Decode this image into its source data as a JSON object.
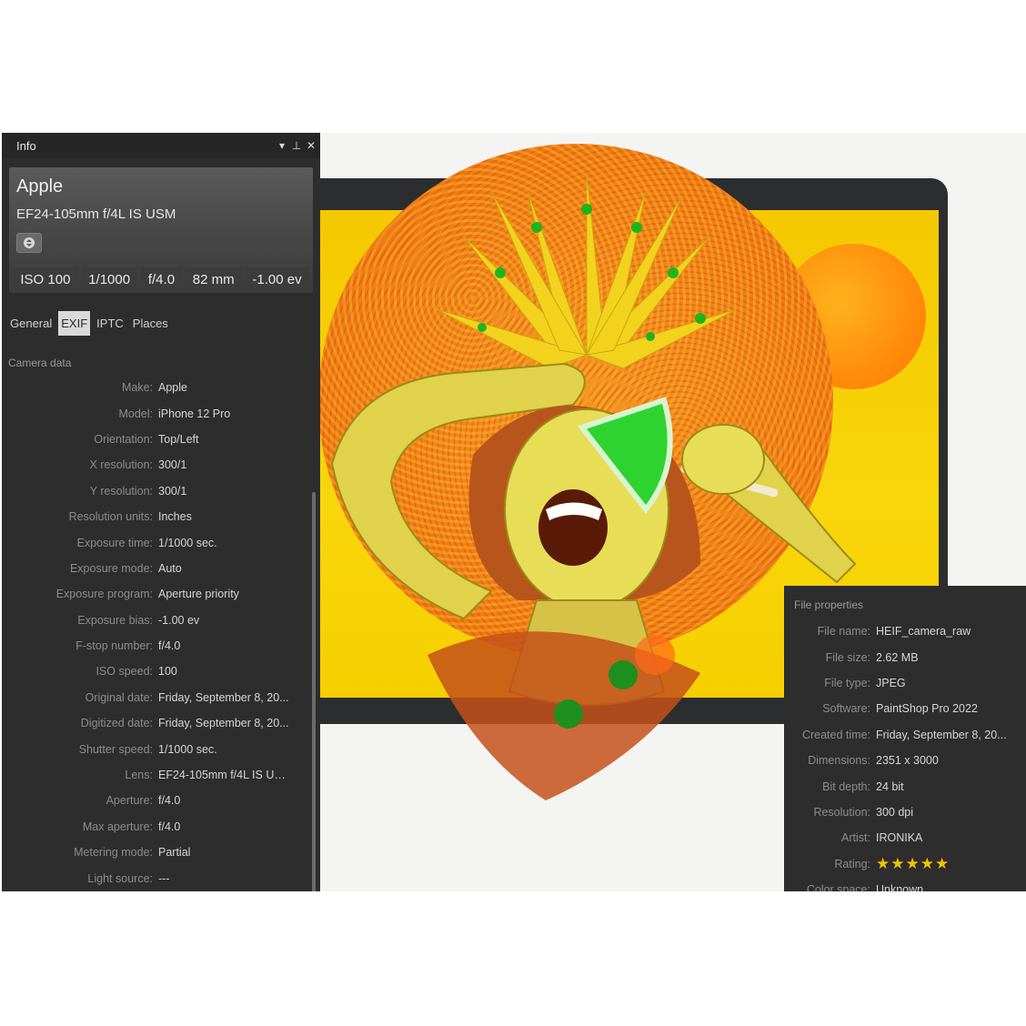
{
  "window": {
    "title": "Info"
  },
  "camera": {
    "make": "Apple",
    "lens": "EF24-105mm f/4L IS USM",
    "stats": [
      "ISO 100",
      "1/1000",
      "f/4.0",
      "82 mm",
      "-1.00 ev"
    ]
  },
  "tabs": [
    {
      "label": "General",
      "active": false
    },
    {
      "label": "EXIF",
      "active": true
    },
    {
      "label": "IPTC",
      "active": false
    },
    {
      "label": "Places",
      "active": false
    }
  ],
  "exif": {
    "section": "Camera data",
    "rows": [
      {
        "key": "Make:",
        "value": "Apple"
      },
      {
        "key": "Model:",
        "value": "iPhone 12 Pro"
      },
      {
        "key": "Orientation:",
        "value": "Top/Left"
      },
      {
        "key": "X resolution:",
        "value": "300/1"
      },
      {
        "key": "Y resolution:",
        "value": "300/1"
      },
      {
        "key": "Resolution units:",
        "value": "Inches"
      },
      {
        "key": "Exposure time:",
        "value": "1/1000 sec."
      },
      {
        "key": "Exposure mode:",
        "value": "Auto"
      },
      {
        "key": "Exposure program:",
        "value": "Aperture priority"
      },
      {
        "key": "Exposure bias:",
        "value": "-1.00 ev"
      },
      {
        "key": "F-stop number:",
        "value": "f/4.0"
      },
      {
        "key": "ISO speed:",
        "value": "100"
      },
      {
        "key": "Original date:",
        "value": "Friday, September 8, 20..."
      },
      {
        "key": "Digitized date:",
        "value": "Friday, September 8, 20..."
      },
      {
        "key": "Shutter speed:",
        "value": "1/1000 sec."
      },
      {
        "key": "Lens:",
        "value": "EF24-105mm f/4L IS USM"
      },
      {
        "key": "Aperture:",
        "value": "f/4.0"
      },
      {
        "key": "Max aperture:",
        "value": "f/4.0"
      },
      {
        "key": "Metering mode:",
        "value": "Partial"
      },
      {
        "key": "Light source:",
        "value": "---"
      }
    ]
  },
  "file_properties": {
    "section": "File properties",
    "rows": [
      {
        "key": "File name:",
        "value": "HEIF_camera_raw"
      },
      {
        "key": "File size:",
        "value": "2.62 MB"
      },
      {
        "key": "File type:",
        "value": "JPEG"
      },
      {
        "key": "Software:",
        "value": "PaintShop Pro 2022"
      },
      {
        "key": "Created time:",
        "value": "Friday, September 8, 20..."
      },
      {
        "key": "Dimensions:",
        "value": "2351 x 3000"
      },
      {
        "key": "Bit depth:",
        "value": "24 bit"
      },
      {
        "key": "Resolution:",
        "value": "300 dpi"
      },
      {
        "key": "Artist:",
        "value": "IRONIKA"
      },
      {
        "key": "Rating:",
        "value": "★★★★★"
      },
      {
        "key": "Color space:",
        "value": "Unknown"
      }
    ],
    "rating_stars": 5
  },
  "colors": {
    "panel_bg": "#2d2d2d",
    "accent_yellow": "#f5c800",
    "accent_orange": "#f07a10",
    "star": "#f2c200"
  }
}
